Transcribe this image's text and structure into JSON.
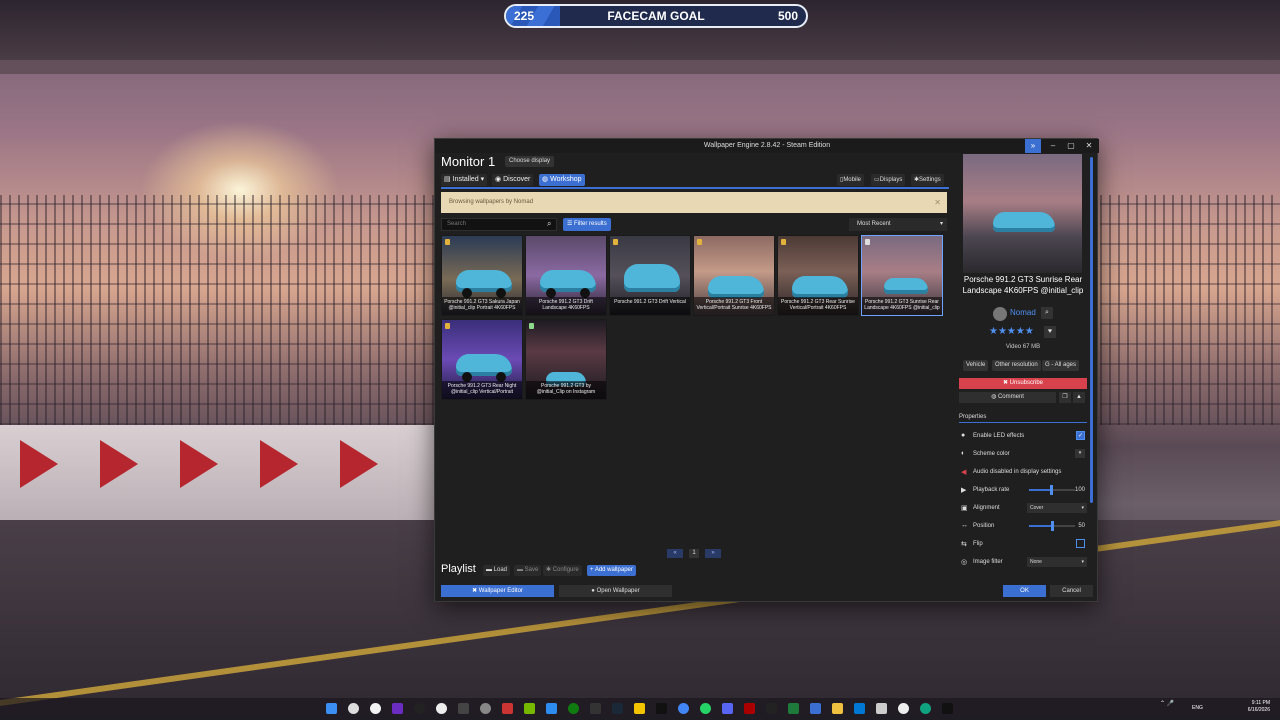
{
  "goal": {
    "start": "225",
    "title": "FACECAM GOAL",
    "end": "500",
    "progress": 0.18
  },
  "window": {
    "title": "Wallpaper Engine 2.8.42 - Steam Edition",
    "monitor": "Monitor 1",
    "choose_display": "Choose display",
    "tabs": [
      "Installed",
      "Discover",
      "Workshop"
    ],
    "right_tabs": [
      "Mobile",
      "Displays",
      "Settings"
    ],
    "banner": "Browsing wallpapers by Nomad",
    "search_placeholder": "Search",
    "filter": "Filter results",
    "sort": "Most Recent"
  },
  "wallpapers": [
    {
      "title": "Porsche 991.2 GT3 Sakura Japan @initial_clip Portrait 4K60FPS"
    },
    {
      "title": "Porsche 991.2 GT3 Drift Landscape 4K60FPS"
    },
    {
      "title": "Porsche 991.2 GT3 Drift Vertical"
    },
    {
      "title": "Porsche 991.2 GT3 Front Vertical/Portrait Sunrise 4K60FPS"
    },
    {
      "title": "Porsche 991.2 GT3 Rear Sunrise Vertical/Portrait 4K60FPS"
    },
    {
      "title": "Porsche 991.2 GT3 Sunrise Rear Landscape 4K60FPS @initial_clip"
    },
    {
      "title": "Porsche 991.2 GT3 Rear Night @initial_clip Vertical/Portrait"
    },
    {
      "title": "Porsche 991.2 GT3 by @initial_Clip on Instagram"
    }
  ],
  "pagination": {
    "prev": "«",
    "page": "1",
    "next": "»"
  },
  "playlist": {
    "title": "Playlist",
    "load": "Load",
    "save": "Save",
    "configure": "Configure",
    "add": "+ Add wallpaper",
    "editor": "Wallpaper Editor",
    "open": "Open Wallpaper"
  },
  "detail": {
    "title": "Porsche 991.2 GT3 Sunrise Rear Landscape 4K60FPS @initial_clip",
    "author": "Nomad",
    "stars": "★★★★★",
    "size": "Video 67 MB",
    "tags": [
      "Vehicle",
      "Other resolution",
      "G - All ages"
    ],
    "unsubscribe": "✖ Unsubscribe",
    "comment": "Comment"
  },
  "properties": {
    "header": "Properties",
    "led": "Enable LED effects",
    "scheme": "Scheme color",
    "audio": "Audio disabled in display settings",
    "playback": "Playback rate",
    "playback_val": "100",
    "alignment": "Alignment",
    "alignment_val": "Cover",
    "position": "Position",
    "position_val": "50",
    "flip": "Flip",
    "filter": "Image filter",
    "filter_val": "None"
  },
  "buttons": {
    "ok": "OK",
    "cancel": "Cancel"
  },
  "taskbar": {
    "lang": "ENG",
    "time": "9:11 PM",
    "date": "6/16/2026"
  }
}
